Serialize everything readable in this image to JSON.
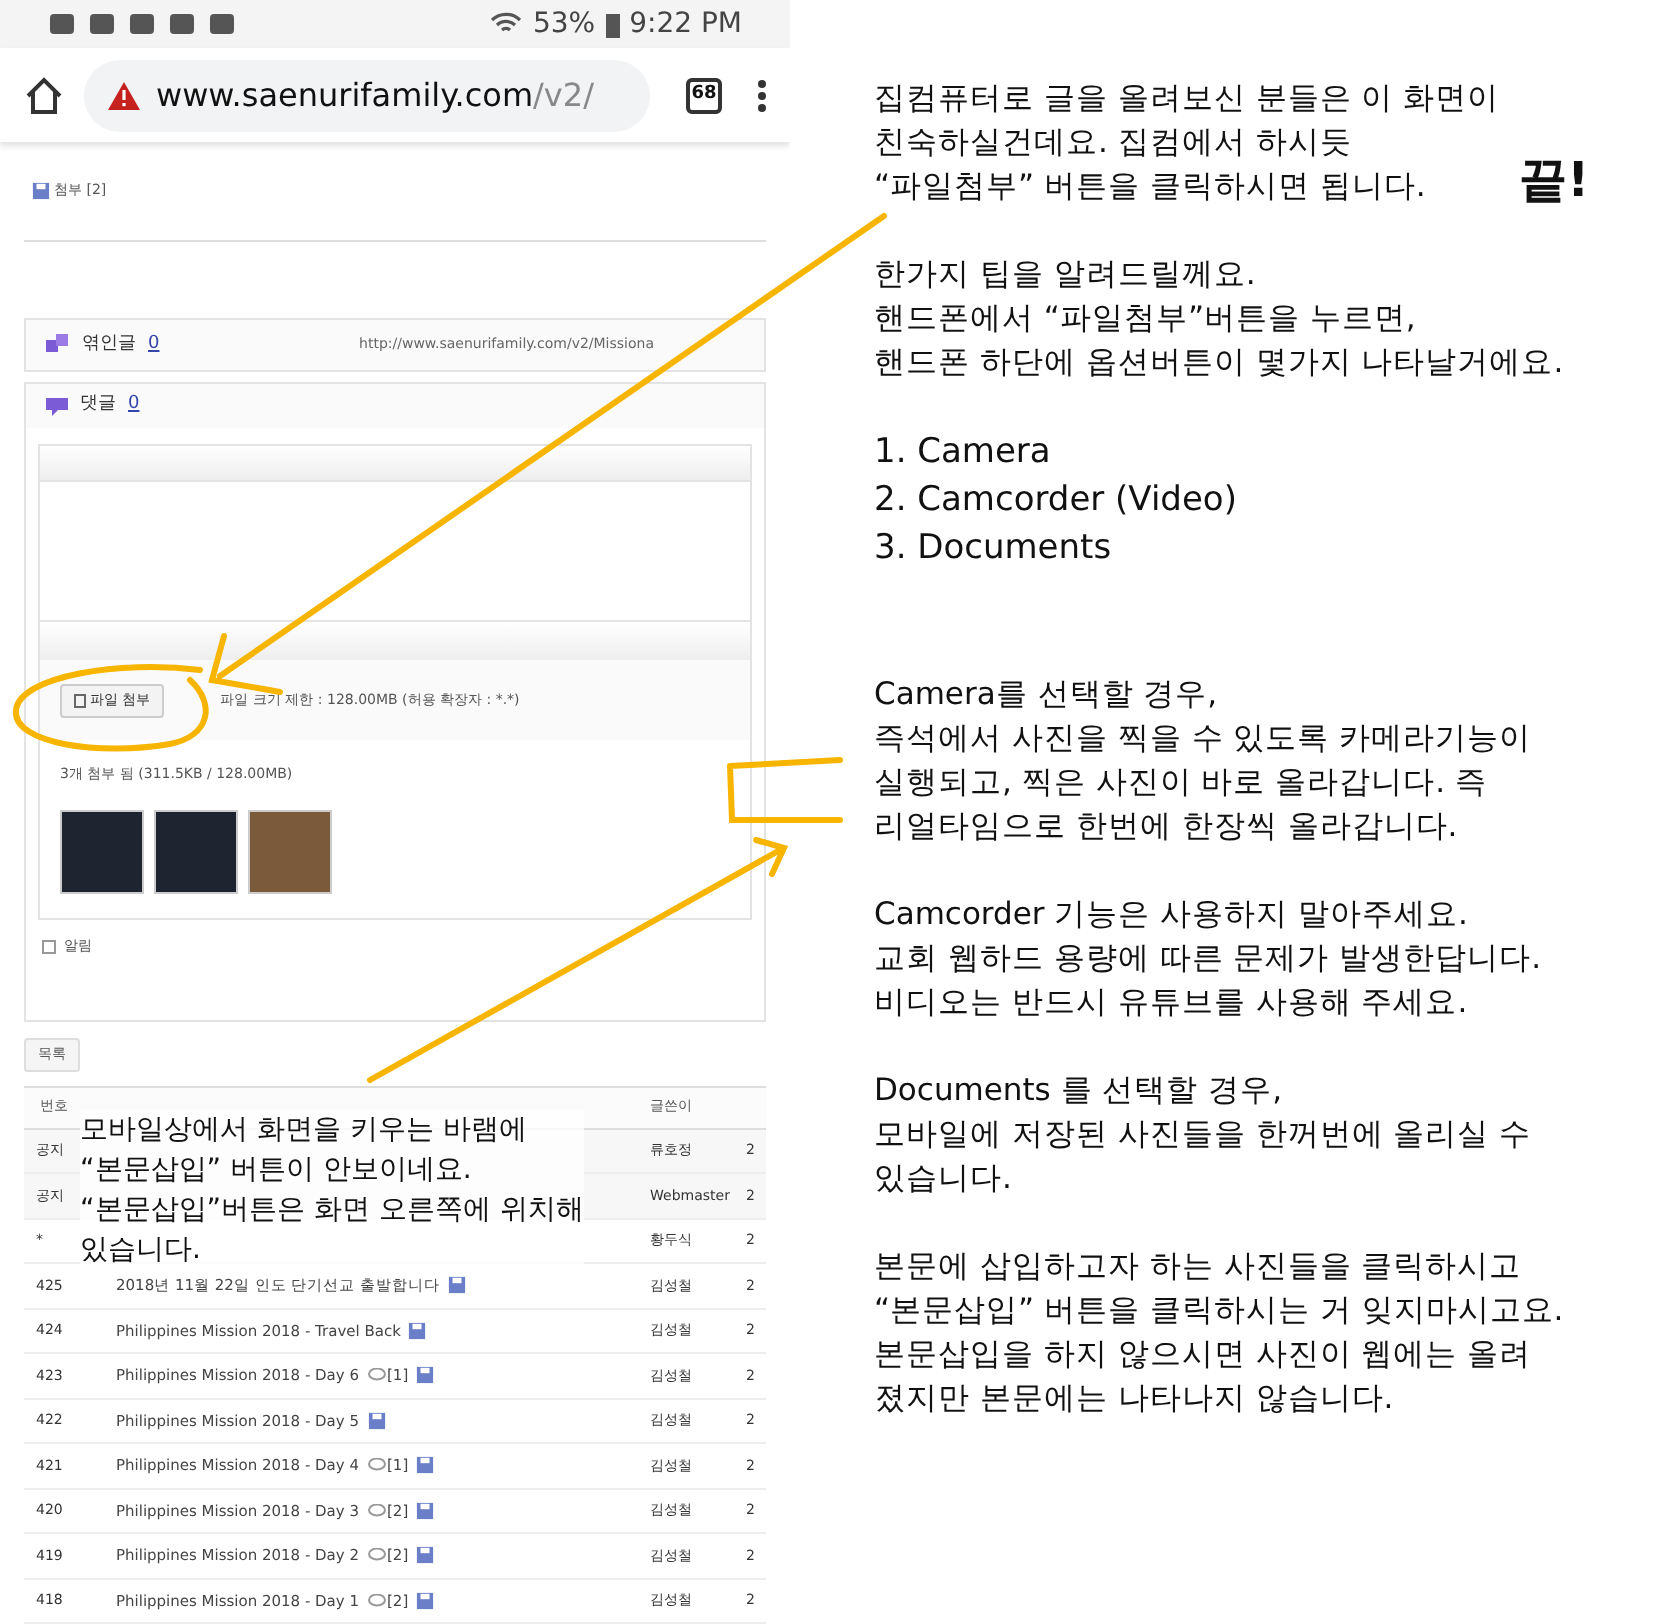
{
  "status_bar": {
    "battery": "53%",
    "time": "9:22 PM"
  },
  "browser": {
    "url_host": "www.saenurifamily.com",
    "url_path": "/v2/",
    "tab_count": "68"
  },
  "post": {
    "attachments": "첨부 [2]",
    "trackback_label": "엮인글",
    "trackback_count": "0",
    "trackback_url": "http://www.saenurifamily.com/v2/Missiona",
    "comments_label": "댓글",
    "comments_count": "0"
  },
  "editor": {
    "attach_button": "파일 첨부",
    "size_limit": "파일 크기 제한 : 128.00MB (허용 확장자 : *.*)",
    "attached_info": "3개 첨부 됨 (311.5KB / 128.00MB)",
    "notify_label": "알림",
    "notify_checked": false,
    "list_button": "목록"
  },
  "table": {
    "columns": [
      "번호",
      "글쓴이"
    ],
    "rows": [
      {
        "number": "공지",
        "title": "",
        "author": "류호정",
        "date": "2",
        "comments": "",
        "file": false
      },
      {
        "number": "공지",
        "title": "",
        "author": "Webmaster",
        "date": "2",
        "comments": "",
        "file": false
      },
      {
        "number": "*",
        "title": "",
        "author": "황두식",
        "date": "2",
        "comments": "",
        "file": false
      },
      {
        "number": "425",
        "title": "2018년 11월 22일 인도 단기선교 출발합니다",
        "author": "김성철",
        "date": "2",
        "comments": "",
        "file": true
      },
      {
        "number": "424",
        "title": "Philippines Mission 2018 - Travel Back",
        "author": "김성철",
        "date": "2",
        "comments": "",
        "file": true
      },
      {
        "number": "423",
        "title": "Philippines Mission 2018 - Day 6",
        "author": "김성철",
        "date": "2",
        "comments": "[1]",
        "file": true
      },
      {
        "number": "422",
        "title": "Philippines Mission 2018 - Day 5",
        "author": "김성철",
        "date": "2",
        "comments": "",
        "file": true
      },
      {
        "number": "421",
        "title": "Philippines Mission 2018 - Day 4",
        "author": "김성철",
        "date": "2",
        "comments": "[1]",
        "file": true
      },
      {
        "number": "420",
        "title": "Philippines Mission 2018 - Day 3",
        "author": "김성철",
        "date": "2",
        "comments": "[2]",
        "file": true
      },
      {
        "number": "419",
        "title": "Philippines Mission 2018 - Day 2",
        "author": "김성철",
        "date": "2",
        "comments": "[2]",
        "file": true
      },
      {
        "number": "418",
        "title": "Philippines Mission 2018 - Day 1",
        "author": "김성철",
        "date": "2",
        "comments": "[2]",
        "file": true
      }
    ]
  },
  "overlay_caption": "모바일상에서 화면을 키우는 바램에\n“본문삽입” 버튼이 안보이네요.\n“본문삽입”버튼은 화면 오른쪽에 위치해\n있습니다.",
  "notes": {
    "intro": "집컴퓨터로 글을 올려보신 분들은 이 화면이\n친숙하실건데요. 집컴에서 하시듯\n“파일첨부” 버튼을 클릭하시면 됩니다.",
    "emphasis": "끝!",
    "tip": "한가지 팁을 알려드릴께요.\n핸드폰에서 “파일첨부”버튼을 누르면,\n핸드폰 하단에 옵션버튼이 몇가지 나타날거에요.",
    "options": [
      "1. Camera",
      "2. Camcorder (Video)",
      "3. Documents"
    ],
    "paragraphs": [
      "Camera를 선택할 경우,\n즉석에서 사진을 찍을 수 있도록 카메라기능이\n실행되고, 찍은 사진이 바로 올라갑니다. 즉\n리얼타임으로 한번에 한장씩 올라갑니다.",
      "Camcorder 기능은 사용하지 말아주세요.\n교회 웹하드 용량에 따른 문제가 발생한답니다.\n비디오는 반드시 유튜브를 사용해 주세요.",
      "Documents 를 선택할 경우,\n모바일에 저장된 사진들을 한꺼번에 올리실 수\n있습니다.",
      "본문에 삽입하고자 하는 사진들을 클릭하시고\n“본문삽입” 버튼을 클릭하시는 거 잊지마시고요.\n본문삽입을 하지 않으시면 사진이 웹에는 올려\n졌지만 본문에는 나타나지 않습니다."
    ]
  }
}
